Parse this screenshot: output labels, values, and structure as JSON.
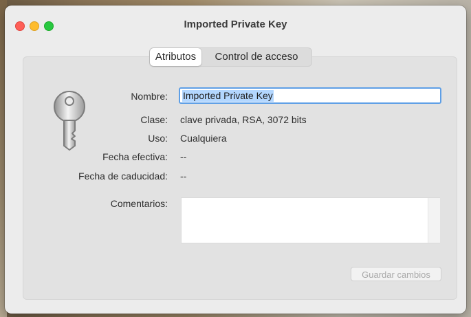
{
  "window": {
    "title": "Imported Private Key"
  },
  "tabs": [
    {
      "label": "Atributos",
      "active": true
    },
    {
      "label": "Control de acceso",
      "active": false
    }
  ],
  "fields": {
    "name_label": "Nombre:",
    "name_value": "Imported Private Key",
    "class_label": "Clase:",
    "class_value": "clave privada, RSA, 3072 bits",
    "use_label": "Uso:",
    "use_value": "Cualquiera",
    "effective_label": "Fecha efectiva:",
    "effective_value": "--",
    "expiry_label": "Fecha de caducidad:",
    "expiry_value": "--",
    "comments_label": "Comentarios:",
    "comments_value": ""
  },
  "buttons": {
    "save_label": "Guardar cambios"
  },
  "colors": {
    "close": "#fe5f57",
    "minimize": "#febc2e",
    "maximize": "#28c840",
    "focus_ring": "#5e9fe6",
    "selection": "#b3d7ff"
  },
  "icons": [
    "key-icon"
  ]
}
